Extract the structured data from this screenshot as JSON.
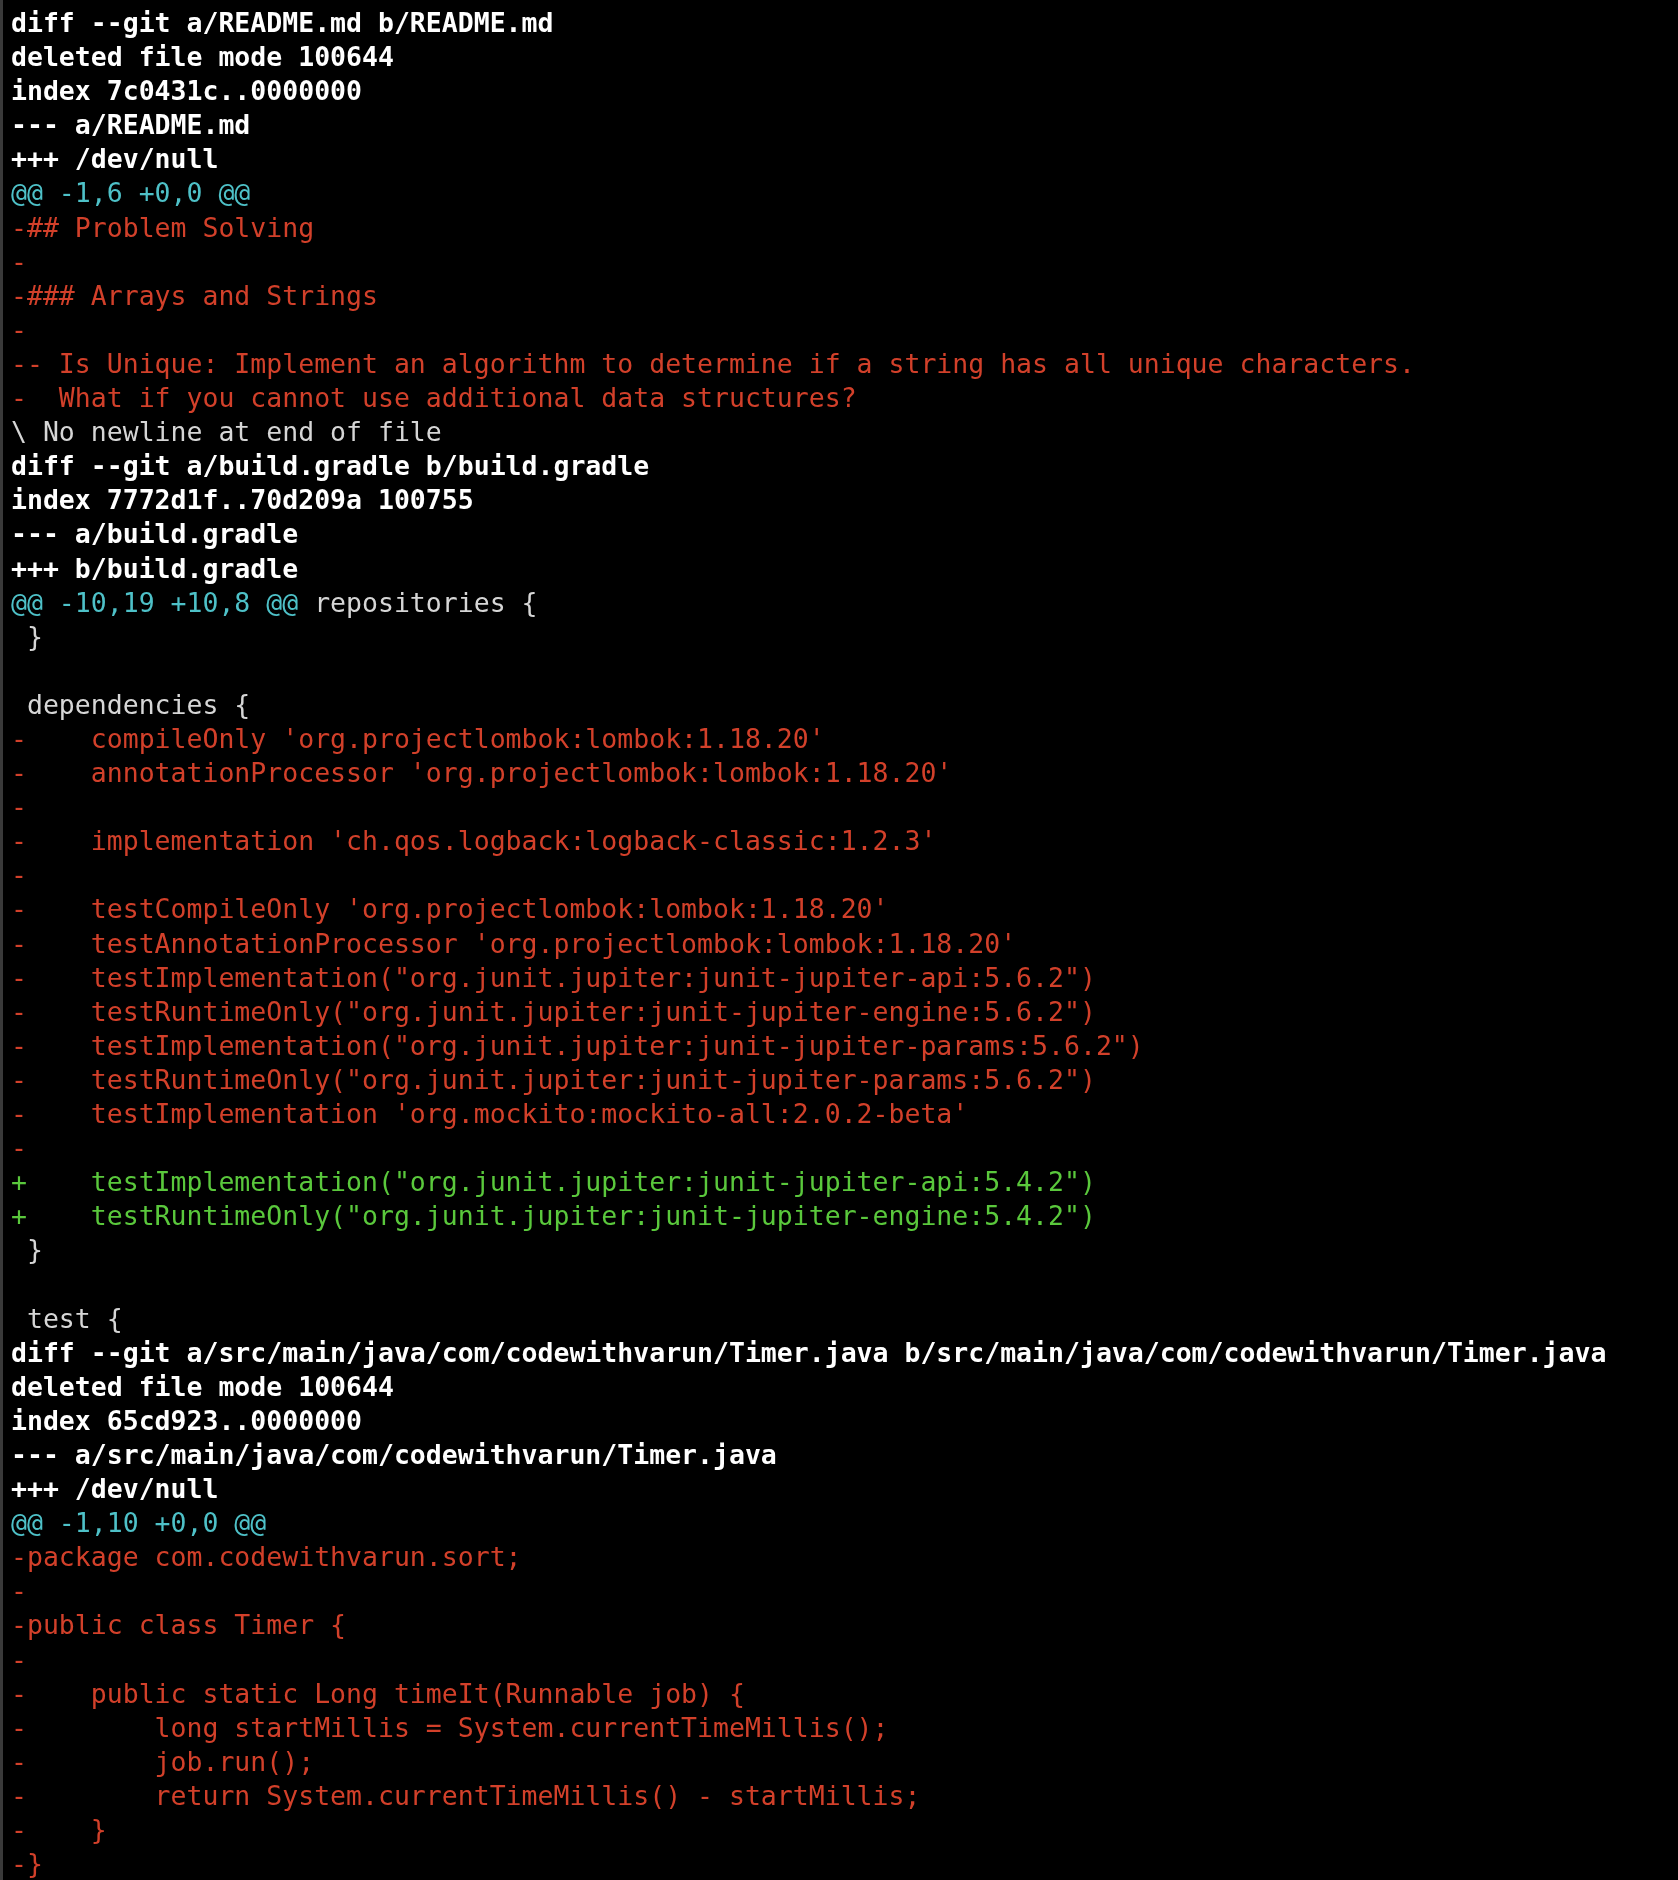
{
  "lines": [
    {
      "kind": "header",
      "text": "diff --git a/README.md b/README.md"
    },
    {
      "kind": "header",
      "text": "deleted file mode 100644"
    },
    {
      "kind": "header",
      "text": "index 7c0431c..0000000"
    },
    {
      "kind": "header",
      "text": "--- a/README.md"
    },
    {
      "kind": "header",
      "text": "+++ /dev/null"
    },
    {
      "kind": "hunk",
      "text": "@@ -1,6 +0,0 @@"
    },
    {
      "kind": "removed",
      "text": "-## Problem Solving"
    },
    {
      "kind": "removed",
      "text": "-"
    },
    {
      "kind": "removed",
      "text": "-### Arrays and Strings"
    },
    {
      "kind": "removed",
      "text": "-"
    },
    {
      "kind": "removed",
      "text": "-- Is Unique: Implement an algorithm to determine if a string has all unique characters."
    },
    {
      "kind": "removed",
      "text": "-  What if you cannot use additional data structures?"
    },
    {
      "kind": "meta",
      "text": "\\ No newline at end of file"
    },
    {
      "kind": "header",
      "text": "diff --git a/build.gradle b/build.gradle"
    },
    {
      "kind": "header",
      "text": "index 7772d1f..70d209a 100755"
    },
    {
      "kind": "header",
      "text": "--- a/build.gradle"
    },
    {
      "kind": "header",
      "text": "+++ b/build.gradle"
    },
    {
      "kind": "hunk",
      "text": "@@ -10,19 +10,8 @@",
      "context": "repositories {"
    },
    {
      "kind": "context",
      "text": " }"
    },
    {
      "kind": "blank"
    },
    {
      "kind": "context",
      "text": " dependencies {"
    },
    {
      "kind": "removed",
      "text": "-    compileOnly 'org.projectlombok:lombok:1.18.20'"
    },
    {
      "kind": "removed",
      "text": "-    annotationProcessor 'org.projectlombok:lombok:1.18.20'"
    },
    {
      "kind": "removed",
      "text": "-"
    },
    {
      "kind": "removed",
      "text": "-    implementation 'ch.qos.logback:logback-classic:1.2.3'"
    },
    {
      "kind": "removed",
      "text": "-"
    },
    {
      "kind": "removed",
      "text": "-    testCompileOnly 'org.projectlombok:lombok:1.18.20'"
    },
    {
      "kind": "removed",
      "text": "-    testAnnotationProcessor 'org.projectlombok:lombok:1.18.20'"
    },
    {
      "kind": "removed",
      "text": "-    testImplementation(\"org.junit.jupiter:junit-jupiter-api:5.6.2\")"
    },
    {
      "kind": "removed",
      "text": "-    testRuntimeOnly(\"org.junit.jupiter:junit-jupiter-engine:5.6.2\")"
    },
    {
      "kind": "removed",
      "text": "-    testImplementation(\"org.junit.jupiter:junit-jupiter-params:5.6.2\")"
    },
    {
      "kind": "removed",
      "text": "-    testRuntimeOnly(\"org.junit.jupiter:junit-jupiter-params:5.6.2\")"
    },
    {
      "kind": "removed",
      "text": "-    testImplementation 'org.mockito:mockito-all:2.0.2-beta'"
    },
    {
      "kind": "removed",
      "text": "-"
    },
    {
      "kind": "added",
      "text": "+    testImplementation(\"org.junit.jupiter:junit-jupiter-api:5.4.2\")"
    },
    {
      "kind": "added",
      "text": "+    testRuntimeOnly(\"org.junit.jupiter:junit-jupiter-engine:5.4.2\")"
    },
    {
      "kind": "context",
      "text": " }"
    },
    {
      "kind": "blank"
    },
    {
      "kind": "context",
      "text": " test {"
    },
    {
      "kind": "header",
      "text": "diff --git a/src/main/java/com/codewithvarun/Timer.java b/src/main/java/com/codewithvarun/Timer.java"
    },
    {
      "kind": "header",
      "text": "deleted file mode 100644"
    },
    {
      "kind": "header",
      "text": "index 65cd923..0000000"
    },
    {
      "kind": "header",
      "text": "--- a/src/main/java/com/codewithvarun/Timer.java"
    },
    {
      "kind": "header",
      "text": "+++ /dev/null"
    },
    {
      "kind": "hunk",
      "text": "@@ -1,10 +0,0 @@"
    },
    {
      "kind": "removed",
      "text": "-package com.codewithvarun.sort;"
    },
    {
      "kind": "removed",
      "text": "-"
    },
    {
      "kind": "removed",
      "text": "-public class Timer {"
    },
    {
      "kind": "removed",
      "text": "-"
    },
    {
      "kind": "removed",
      "text": "-    public static Long timeIt(Runnable job) {"
    },
    {
      "kind": "removed",
      "text": "-        long startMillis = System.currentTimeMillis();"
    },
    {
      "kind": "removed",
      "text": "-        job.run();"
    },
    {
      "kind": "removed",
      "text": "-        return System.currentTimeMillis() - startMillis;"
    },
    {
      "kind": "removed",
      "text": "-    }"
    },
    {
      "kind": "removed",
      "text": "-}"
    }
  ]
}
